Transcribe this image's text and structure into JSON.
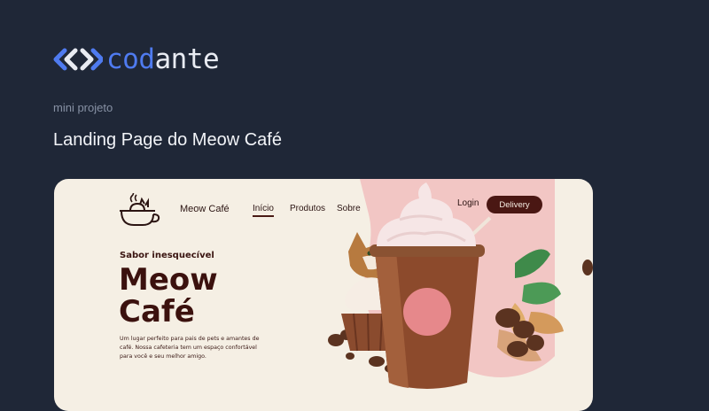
{
  "brand": {
    "icon": "double-chevron-icon",
    "prefix": "cod",
    "suffix": "ante",
    "colors": {
      "accent": "#4f7bf0",
      "text": "#e8ebf2",
      "background": "#1f2737"
    }
  },
  "kicker": "mini projeto",
  "headline": "Landing Page do Meow Café",
  "preview": {
    "nav": {
      "logo_icon": "cat-in-cup-icon",
      "brand": "Meow Café",
      "links": [
        "Início",
        "Produtos",
        "Sobre"
      ],
      "active_link": "Início",
      "login": "Login",
      "delivery": "Delivery"
    },
    "hero": {
      "tagline": "Sabor inesquecível",
      "title_line1": "Meow",
      "title_line2": "Café",
      "description": "Um lugar perfeito para pais de pets e amantes de café. Nossa cafeteria tem um espaço confortável para você e seu melhor amigo."
    },
    "colors": {
      "card": "#f5efe4",
      "dark_brown": "#3b110e",
      "pink": "#f2c6c4",
      "button": "#4a1713"
    }
  }
}
